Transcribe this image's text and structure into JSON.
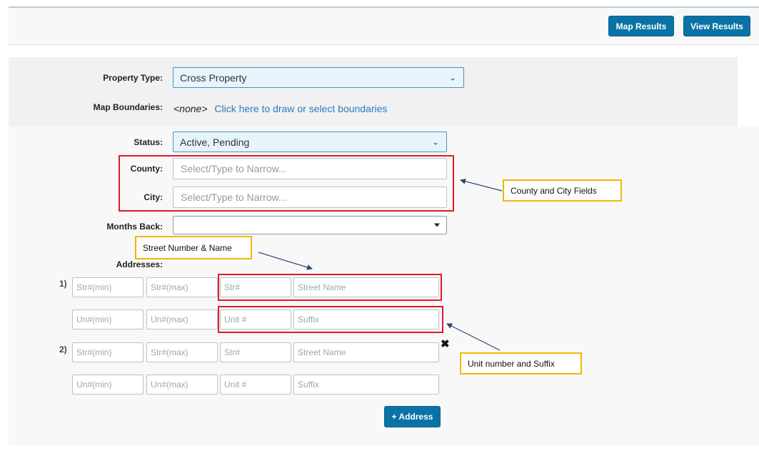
{
  "toolbar": {
    "map_results_label": "Map Results",
    "view_results_label": "View Results"
  },
  "form": {
    "property_type": {
      "label": "Property Type:",
      "value": "Cross Property"
    },
    "map_boundaries": {
      "label": "Map Boundaries:",
      "none_text": "<none>",
      "link_text": "Click here to draw or select boundaries"
    },
    "status": {
      "label": "Status:",
      "value": "Active, Pending"
    },
    "county": {
      "label": "County:",
      "placeholder": "Select/Type to Narrow..."
    },
    "city": {
      "label": "City:",
      "placeholder": "Select/Type to Narrow..."
    },
    "months_back": {
      "label": "Months Back:",
      "value": ""
    },
    "addresses": {
      "label": "Addresses:",
      "rows": [
        {
          "number": "1)",
          "str_min": "Str#(min)",
          "str_max": "Str#(max)",
          "str_num": "Str#",
          "street_name": "Street Name",
          "un_min": "Un#(min)",
          "un_max": "Un#(max)",
          "unit_num": "Unit #",
          "suffix": "Suffix"
        },
        {
          "number": "2)",
          "str_min": "Str#(min)",
          "str_max": "Str#(max)",
          "str_num": "Str#",
          "street_name": "Street Name",
          "un_min": "Un#(min)",
          "un_max": "Un#(max)",
          "unit_num": "Unit #",
          "suffix": "Suffix",
          "remove_glyph": "✖"
        }
      ],
      "add_button_label": "+ Address"
    }
  },
  "annotations": {
    "county_city_label": "County and City Fields",
    "street_label": "Street Number & Name",
    "unit_label": "Unit number and Suffix"
  },
  "colors": {
    "button_blue": "#0b72a6",
    "highlight_red": "#e01b24",
    "callout_yellow": "#f2b705",
    "arrow_navy": "#2b4a6e"
  },
  "icons": {
    "dropdown": "chevron-down-icon",
    "select_caret": "caret-down-icon",
    "remove": "close-icon"
  }
}
